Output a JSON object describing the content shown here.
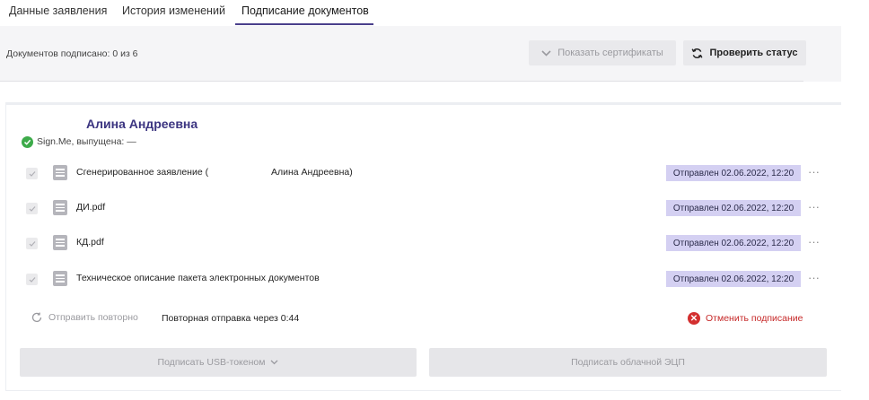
{
  "tabs": [
    {
      "label": "Данные заявления"
    },
    {
      "label": "История изменений"
    },
    {
      "label": "Подписание документов"
    }
  ],
  "active_tab": 2,
  "header": {
    "signed_count": "Документов подписано: 0 из 6",
    "show_certs_label": "Показать сертификаты",
    "check_status_label": "Проверить статус"
  },
  "signer": {
    "name": "Алина Андреевна",
    "provider_info": "Sign.Me, выпущена: —"
  },
  "documents": [
    {
      "name": "Сгенерированное заявление (",
      "name_extra": "Алина Андреевна)",
      "status": "Отправлен 02.06.2022, 12:20"
    },
    {
      "name": "ДИ.pdf",
      "status": "Отправлен 02.06.2022, 12:20"
    },
    {
      "name": "КД.pdf",
      "status": "Отправлен 02.06.2022, 12:20"
    },
    {
      "name": "Техническое описание пакета электронных документов",
      "status": "Отправлен 02.06.2022, 12:20"
    }
  ],
  "actions": {
    "resend_label": "Отправить повторно",
    "resend_timer": "Повторная отправка через 0:44",
    "cancel_label": "Отменить подписание",
    "sign_usb_label": "Подписать USB-токеном",
    "sign_cloud_label": "Подписать облачной ЭЦП"
  },
  "colors": {
    "accent": "#3b3480",
    "status_badge": "#d4d0f2",
    "success": "#3dab4a",
    "danger": "#d32f2f"
  }
}
